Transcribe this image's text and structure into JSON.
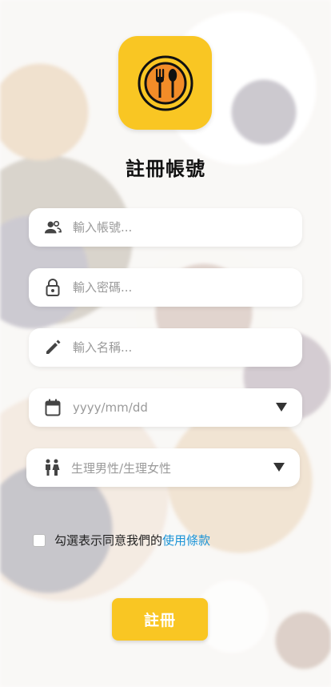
{
  "app": {
    "title": "註冊帳號",
    "brand_color": "#f9c623",
    "logo_icon": "fork-spoon-plate-icon"
  },
  "form": {
    "account": {
      "icon": "user-group-icon",
      "placeholder": "輸入帳號...",
      "value": ""
    },
    "password": {
      "icon": "lock-icon",
      "placeholder": "輸入密碼...",
      "value": ""
    },
    "name": {
      "icon": "pencil-icon",
      "placeholder": "輸入名稱...",
      "value": ""
    },
    "birthday": {
      "icon": "calendar-icon",
      "placeholder": "yyyy/mm/dd",
      "dropdown_icon": "caret-down-icon"
    },
    "gender": {
      "icon": "male-female-icon",
      "placeholder": "生理男性/生理女性",
      "dropdown_icon": "caret-down-icon"
    }
  },
  "terms": {
    "checked": false,
    "text": "勾選表示同意我們的",
    "link_text": "使用條款",
    "link_color": "#1a93d6"
  },
  "submit": {
    "label": "註冊"
  }
}
